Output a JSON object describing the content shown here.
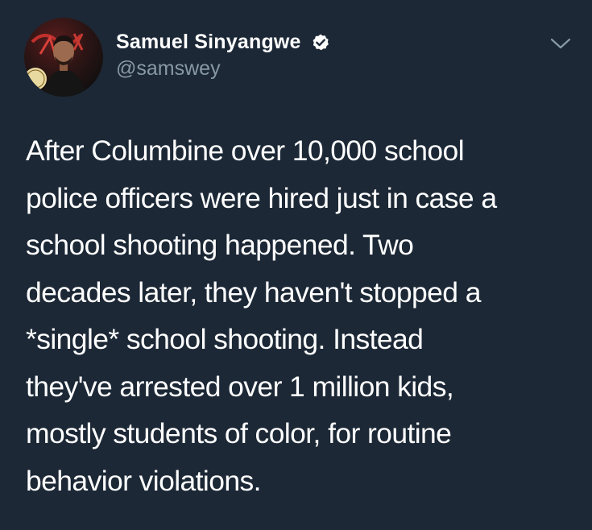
{
  "author": {
    "display_name": "Samuel Sinyangwe",
    "handle": "@samswey",
    "verified": true,
    "avatar_icon": "profile-photo"
  },
  "menu": {
    "icon": "chevron-down-icon"
  },
  "tweet": {
    "text": "After Columbine over 10,000 school\npolice officers were hired just in case a\nschool shooting happened. Two\ndecades later, they haven't stopped a\n*single* school shooting. Instead\nthey've arrested over 1 million kids,\nmostly students of color, for routine\nbehavior violations."
  },
  "colors": {
    "background": "#1c2836",
    "text": "#ffffff",
    "secondary_text": "#8899a6",
    "verified_badge": "#ffffff"
  }
}
